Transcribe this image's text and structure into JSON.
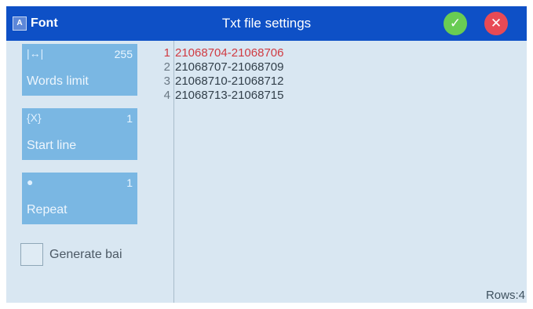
{
  "titlebar": {
    "font_label": "Font",
    "font_icon_glyph": "A",
    "title": "Txt file settings",
    "confirm_glyph": "✓",
    "cancel_glyph": "✕"
  },
  "sidebar": {
    "words_limit": {
      "icon": "|↔|",
      "value": "255",
      "label": "Words limit"
    },
    "start_line": {
      "icon": "{X}",
      "value": "1",
      "label": "Start line"
    },
    "repeat": {
      "icon": "●",
      "value": "1",
      "label": "Repeat"
    },
    "generate_label": "Generate bai"
  },
  "list": {
    "rows": [
      {
        "num": "1",
        "value": "21068704-21068706"
      },
      {
        "num": "2",
        "value": "21068707-21068709"
      },
      {
        "num": "3",
        "value": "21068710-21068712"
      },
      {
        "num": "4",
        "value": "21068713-21068715"
      }
    ],
    "selected_index": 0
  },
  "footer": {
    "rows_label": "Rows:4"
  },
  "colors": {
    "titlebar": "#0e50c6",
    "confirm": "#69cc53",
    "cancel": "#e84a55",
    "card": "#7ab7e3",
    "selected_text": "#d03b42",
    "background": "#d9e7f2"
  },
  "icons": [
    "font-icon",
    "confirm-icon",
    "cancel-icon",
    "words-limit-icon",
    "start-line-icon",
    "repeat-icon"
  ]
}
